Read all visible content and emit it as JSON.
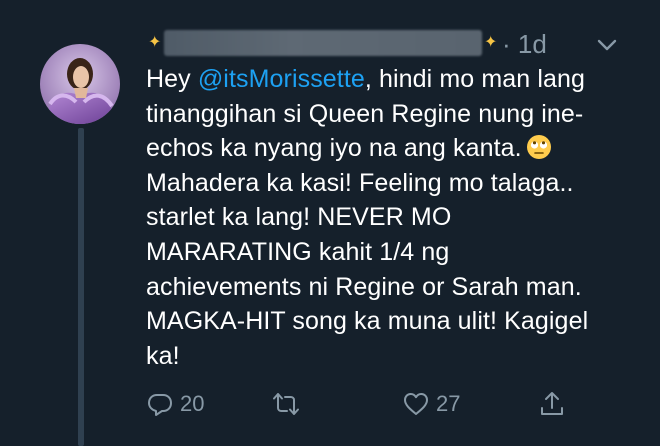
{
  "header": {
    "timestamp": "· 1d"
  },
  "tweet": {
    "mention": "@itsMorissette",
    "lines": [
      {
        "before": "Hey ",
        "after": ", hindi mo man lang"
      },
      "tinanggihan si Queen Regine nung ine-",
      "echos ka nyang iyo na ang kanta.",
      "Mahadera ka kasi! Feeling mo talaga..",
      "starlet ka lang! NEVER MO",
      "MARARATING kahit 1/4 ng",
      "achievements ni Regine or Sarah man.",
      "MAGKA-HIT song ka muna ulit! Kagigel",
      "ka!"
    ],
    "emoji": "face-with-rolling-eyes"
  },
  "actions": {
    "reply_count": "20",
    "retweet_count": "",
    "like_count": "27"
  },
  "colors": {
    "background": "#15202b",
    "accent": "#1da1f2",
    "muted": "#8899a6"
  },
  "icons": [
    "sparkles-icon",
    "chevron-down-icon",
    "reply-icon",
    "retweet-icon",
    "heart-icon",
    "share-icon"
  ]
}
